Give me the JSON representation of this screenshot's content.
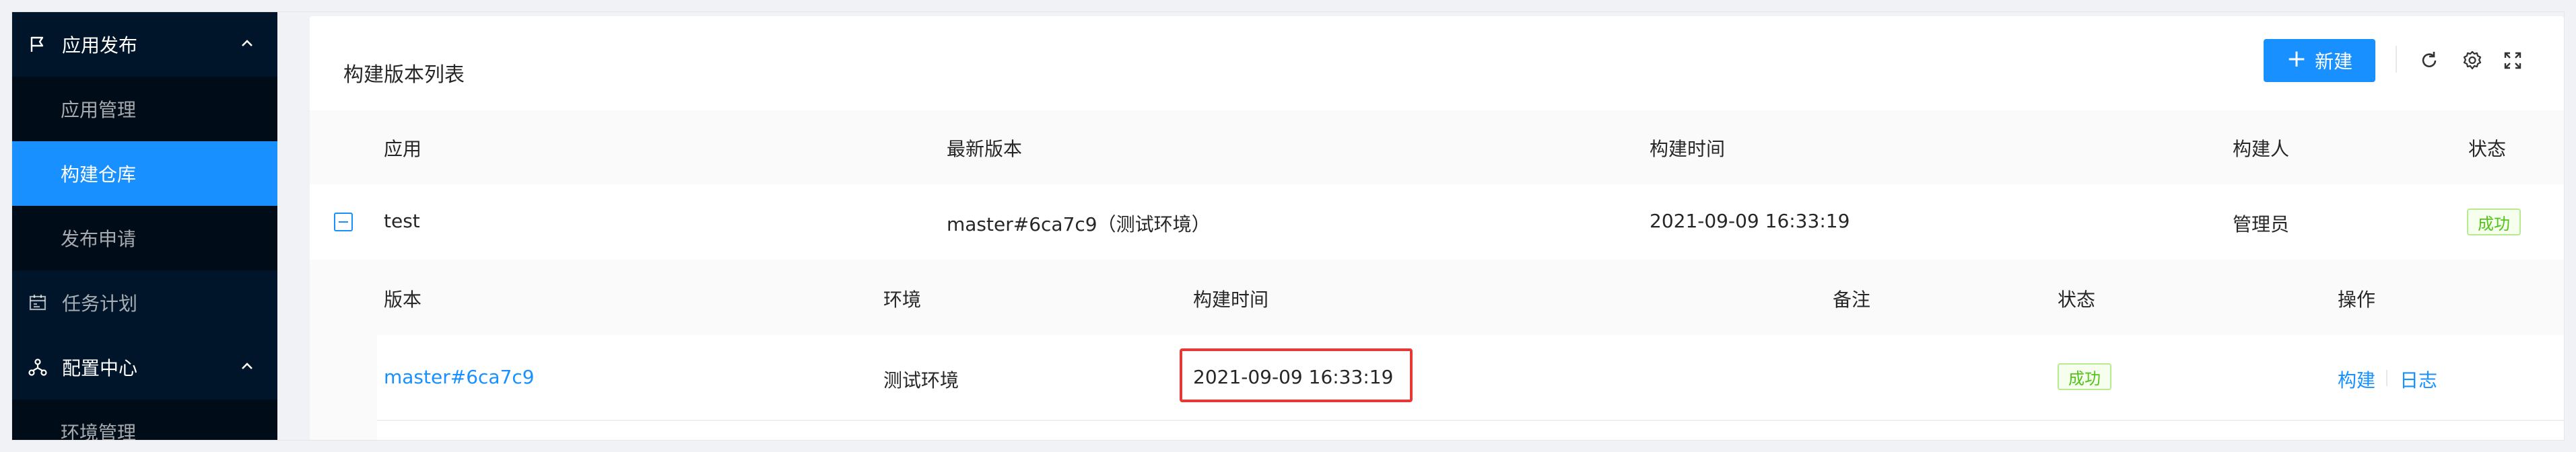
{
  "sidebar": {
    "groups": [
      {
        "label": "应用发布",
        "icon": "flag-icon",
        "expanded": true
      },
      {
        "label": "配置中心",
        "icon": "cluster-icon",
        "expanded": true
      }
    ],
    "items": [
      {
        "label": "应用管理",
        "active": false
      },
      {
        "label": "构建仓库",
        "active": true
      },
      {
        "label": "发布申请",
        "active": false
      },
      {
        "label": "任务计划",
        "icon": "schedule-icon"
      },
      {
        "label": "环境管理",
        "active": false
      }
    ]
  },
  "card": {
    "title": "构建版本列表",
    "new_button": "新建",
    "tools": [
      "reload-icon",
      "setting-icon",
      "fullscreen-icon"
    ]
  },
  "table": {
    "columns": [
      "应用",
      "最新版本",
      "构建时间",
      "构建人",
      "状态"
    ],
    "rows": [
      {
        "app": "test",
        "latest_version": "master#6ca7c9（测试环境）",
        "build_time": "2021-09-09 16:33:19",
        "builder": "管理员",
        "status": "成功",
        "expanded": true
      }
    ]
  },
  "nested": {
    "columns": [
      "版本",
      "环境",
      "构建时间",
      "备注",
      "状态",
      "操作"
    ],
    "rows": [
      {
        "version": "master#6ca7c9",
        "env": "测试环境",
        "build_time": "2021-09-09 16:33:19",
        "remark": "",
        "status": "成功",
        "actions": [
          "构建",
          "日志"
        ]
      }
    ]
  },
  "colors": {
    "sidebar_bg": "#001529",
    "submenu_bg": "#000c17",
    "primary": "#1890ff",
    "success": "#52c41a",
    "highlight": "#e53935"
  }
}
